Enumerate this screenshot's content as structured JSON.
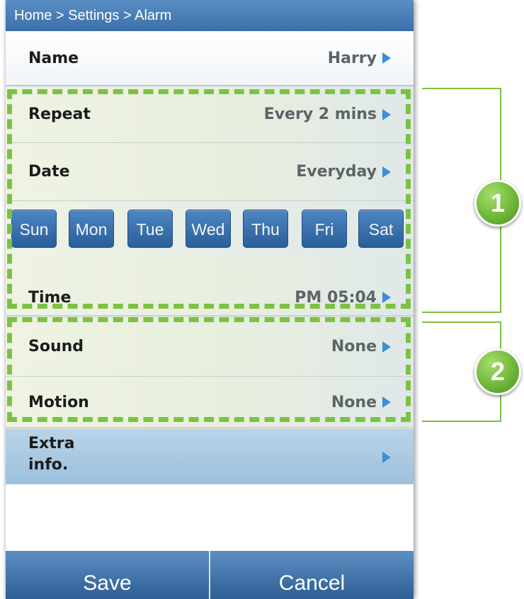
{
  "breadcrumb": "Home > Settings > Alarm",
  "rows": {
    "name": {
      "label": "Name",
      "value": "Harry"
    },
    "repeat": {
      "label": "Repeat",
      "value": "Every 2 mins"
    },
    "date": {
      "label": "Date",
      "value": "Everyday"
    },
    "time": {
      "label": "Time",
      "value": "PM 05:04"
    },
    "sound": {
      "label": "Sound",
      "value": "None"
    },
    "motion": {
      "label": "Motion",
      "value": "None"
    },
    "extra": {
      "label": "Extra\ninfo."
    }
  },
  "days": [
    "Sun",
    "Mon",
    "Tue",
    "Wed",
    "Thu",
    "Fri",
    "Sat"
  ],
  "buttons": {
    "save": "Save",
    "cancel": "Cancel"
  },
  "annotations": {
    "group1": "1",
    "group2": "2"
  },
  "icons": {
    "row_arrow": "play-right-arrow"
  },
  "colors": {
    "accent_green": "#7cc242",
    "button_blue": "#3b6fa7",
    "arrow_blue": "#3c8ed8"
  }
}
